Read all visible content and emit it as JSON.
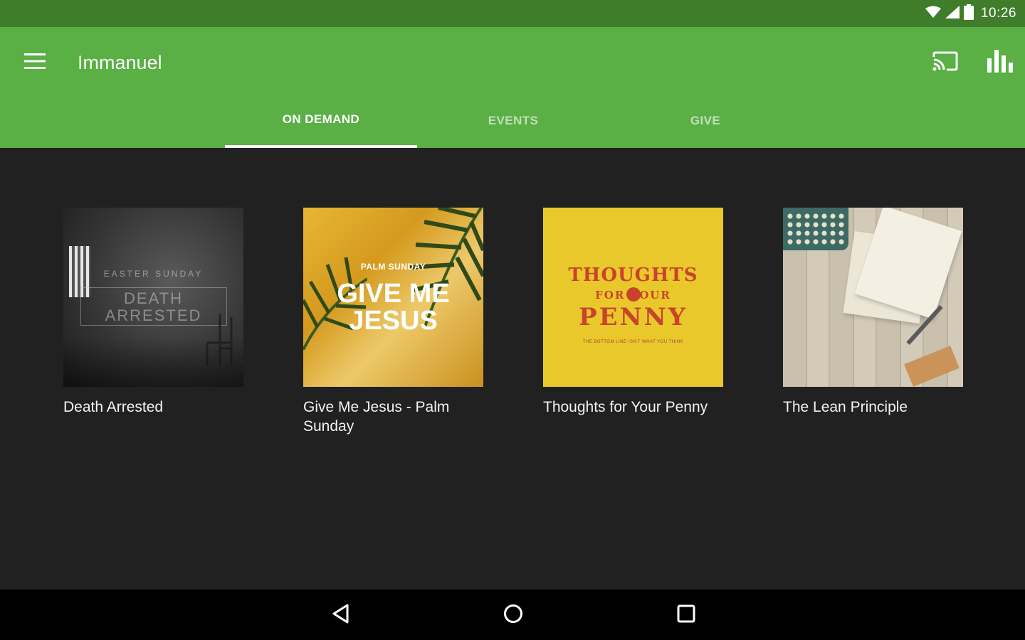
{
  "status_bar": {
    "time": "10:26"
  },
  "app_bar": {
    "title": "Immanuel"
  },
  "tabs": [
    {
      "label": "ON DEMAND",
      "active": true
    },
    {
      "label": "EVENTS",
      "active": false
    },
    {
      "label": "GIVE",
      "active": false
    }
  ],
  "items": [
    {
      "title": "Death Arrested",
      "art": {
        "kicker": "EASTER SUNDAY",
        "line1": "DEATH",
        "line2": "ARRESTED"
      }
    },
    {
      "title": "Give Me Jesus - Palm Sunday",
      "art": {
        "kicker": "PALM SUNDAY",
        "line1": "GIVE ME",
        "line2": "JESUS"
      }
    },
    {
      "title": "Thoughts for Your Penny",
      "art": {
        "line1": "THOUGHTS",
        "line2": "FOR    YOUR",
        "line3": "PENNY",
        "tagline": "THE BOTTOM LINE ISN'T WHAT YOU THINK"
      }
    },
    {
      "title": "The Lean Principle"
    }
  ],
  "colors": {
    "status_bar": "#3f7d2b",
    "app_bar": "#5aaf45",
    "background": "#212121",
    "nav_bar": "#000000"
  },
  "icons": {
    "status": [
      "wifi-icon",
      "signal-icon",
      "battery-icon"
    ],
    "app_bar": [
      "menu-icon",
      "cast-icon",
      "bar-chart-icon"
    ],
    "nav": [
      "back-icon",
      "home-icon",
      "recents-icon"
    ]
  }
}
